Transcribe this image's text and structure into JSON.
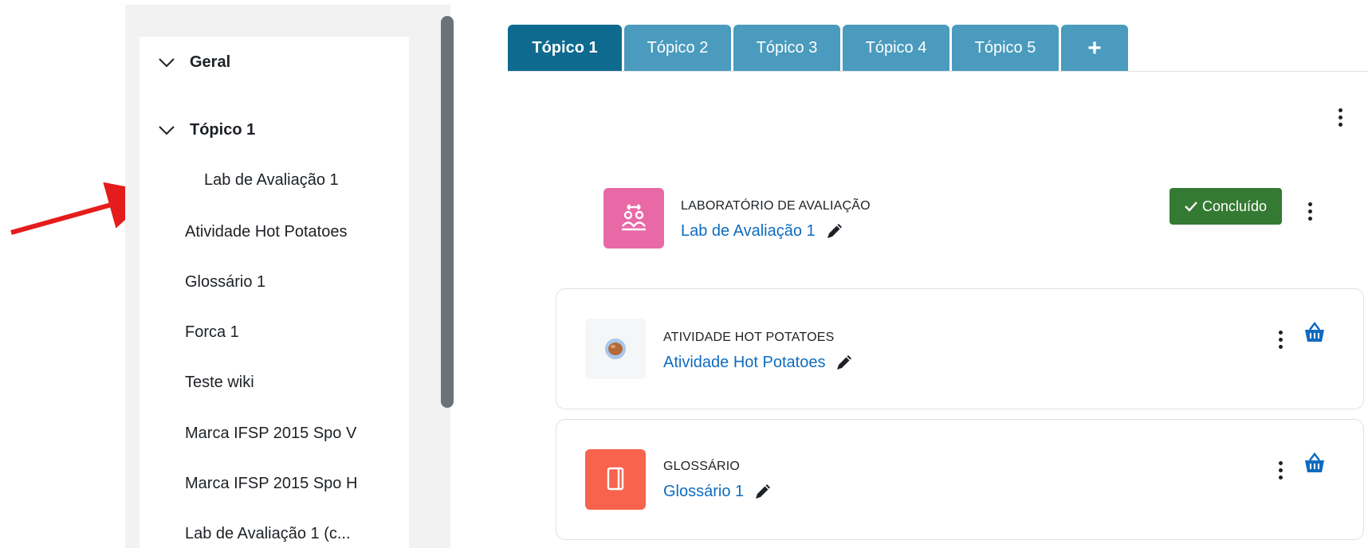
{
  "drawer": {
    "sections": [
      {
        "label": "Geral"
      },
      {
        "label": "Tópico 1"
      }
    ],
    "items": [
      {
        "label": "Lab de Avaliação 1"
      },
      {
        "label": "Atividade Hot Potatoes"
      },
      {
        "label": "Glossário 1"
      },
      {
        "label": "Forca 1"
      },
      {
        "label": "Teste wiki"
      },
      {
        "label": "Marca IFSP 2015 Spo V"
      },
      {
        "label": "Marca IFSP 2015 Spo H"
      },
      {
        "label": "Lab de Avaliação 1 (c..."
      }
    ]
  },
  "tabs": [
    {
      "label": "Tópico 1",
      "active": true
    },
    {
      "label": "Tópico 2"
    },
    {
      "label": "Tópico 3"
    },
    {
      "label": "Tópico 4"
    },
    {
      "label": "Tópico 5"
    },
    {
      "label": "+"
    }
  ],
  "activities": [
    {
      "type": "LABORATÓRIO DE AVALIAÇÃO",
      "name": "Lab de Avaliação 1",
      "icon": "workshop-icon",
      "icon_bg": "#e869a6",
      "completion": "Concluído"
    },
    {
      "type": "ATIVIDADE HOT POTATOES",
      "name": "Atividade Hot Potatoes",
      "icon": "hot-potatoes-icon",
      "icon_bg": "#f5f6f8"
    },
    {
      "type": "GLOSSÁRIO",
      "name": "Glossário 1",
      "icon": "glossary-icon",
      "icon_bg": "#f7634d"
    }
  ],
  "colors": {
    "tab_active": "#0f6a8f",
    "tab": "#4a9bbd",
    "link": "#0f6cbf",
    "completion_badge": "#357a32",
    "annotation_arrow": "#e51c1c"
  }
}
